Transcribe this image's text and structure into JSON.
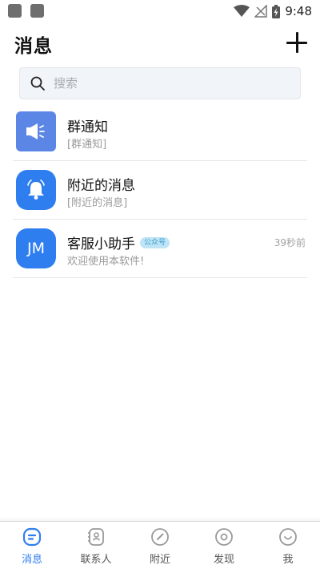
{
  "status_bar": {
    "time": "9:48"
  },
  "header": {
    "title": "消息"
  },
  "search": {
    "placeholder": "搜索"
  },
  "conversations": [
    {
      "title": "群通知",
      "subtitle": "[群通知]",
      "time": "",
      "avatar": "megaphone-icon"
    },
    {
      "title": "附近的消息",
      "subtitle": "[附近的消息]",
      "time": "",
      "avatar": "bell-icon"
    },
    {
      "title": "客服小助手",
      "badge": "公众号",
      "subtitle": "欢迎使用本软件!",
      "time": "39秒前",
      "avatar_text": "JM"
    }
  ],
  "tabs": [
    {
      "label": "消息",
      "icon": "message-icon",
      "active": true
    },
    {
      "label": "联系人",
      "icon": "contacts-icon",
      "active": false
    },
    {
      "label": "附近",
      "icon": "compass-icon",
      "active": false
    },
    {
      "label": "发现",
      "icon": "discover-icon",
      "active": false
    },
    {
      "label": "我",
      "icon": "profile-icon",
      "active": false
    }
  ],
  "colors": {
    "accent": "#2f7ef0",
    "megaphone_bg": "#5b86e6",
    "inactive_icon": "#9a9a9a"
  }
}
